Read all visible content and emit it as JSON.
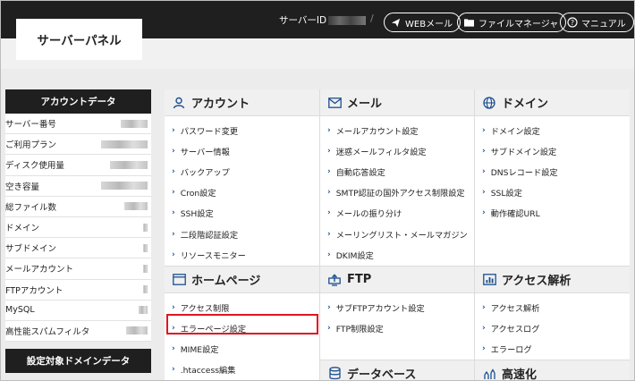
{
  "header": {
    "logo": "サーバーパネル",
    "server_id_label": "サーバーID",
    "separator": "/",
    "buttons": [
      {
        "label": "WEBメール",
        "icon": "paper-plane-icon"
      },
      {
        "label": "ファイルマネージャ",
        "icon": "folder-icon"
      },
      {
        "label": "マニュアル",
        "icon": "help-circle-icon"
      }
    ]
  },
  "sidebar": {
    "account_title": "アカウントデータ",
    "rows": [
      {
        "label": "サーバー番号"
      },
      {
        "label": "ご利用プラン"
      },
      {
        "label": "ディスク使用量"
      },
      {
        "label": "空き容量"
      },
      {
        "label": "総ファイル数"
      },
      {
        "label": "ドメイン"
      },
      {
        "label": "サブドメイン"
      },
      {
        "label": "メールアカウント"
      },
      {
        "label": "FTPアカウント"
      },
      {
        "label": "MySQL"
      },
      {
        "label": "高性能スパムフィルタ"
      }
    ],
    "domain_title": "設定対象ドメインデータ"
  },
  "sections": {
    "account": {
      "title": "アカウント",
      "icon": "user-icon",
      "links": [
        "パスワード変更",
        "サーバー情報",
        "バックアップ",
        "Cron設定",
        "SSH設定",
        "二段階認証設定",
        "リソースモニター"
      ]
    },
    "mail": {
      "title": "メール",
      "icon": "envelope-icon",
      "links": [
        "メールアカウント設定",
        "迷惑メールフィルタ設定",
        "自動応答設定",
        "SMTP認証の国外アクセス制限設定",
        "メールの振り分け",
        "メーリングリスト・メールマガジン",
        "DKIM設定"
      ]
    },
    "domain": {
      "title": "ドメイン",
      "icon": "globe-icon",
      "links": [
        "ドメイン設定",
        "サブドメイン設定",
        "DNSレコード設定",
        "SSL設定",
        "動作確認URL"
      ]
    },
    "homepage": {
      "title": "ホームページ",
      "icon": "browser-window-icon",
      "links": [
        "アクセス制限",
        "エラーページ設定",
        "MIME設定",
        ".htaccess編集"
      ]
    },
    "ftp": {
      "title": "FTP",
      "icon": "upload-monitor-icon",
      "links": [
        "サブFTPアカウント設定",
        "FTP制限設定"
      ]
    },
    "analytics": {
      "title": "アクセス解析",
      "icon": "bar-chart-icon",
      "links": [
        "アクセス解析",
        "アクセスログ",
        "エラーログ"
      ]
    },
    "database": {
      "title": "データベース",
      "icon": "database-icon"
    },
    "speed": {
      "title": "高速化",
      "icon": "speed-icon"
    }
  },
  "colors": {
    "header_bg": "#1f1f1f",
    "accent": "#1b4f91",
    "highlight": "#e0161f"
  }
}
